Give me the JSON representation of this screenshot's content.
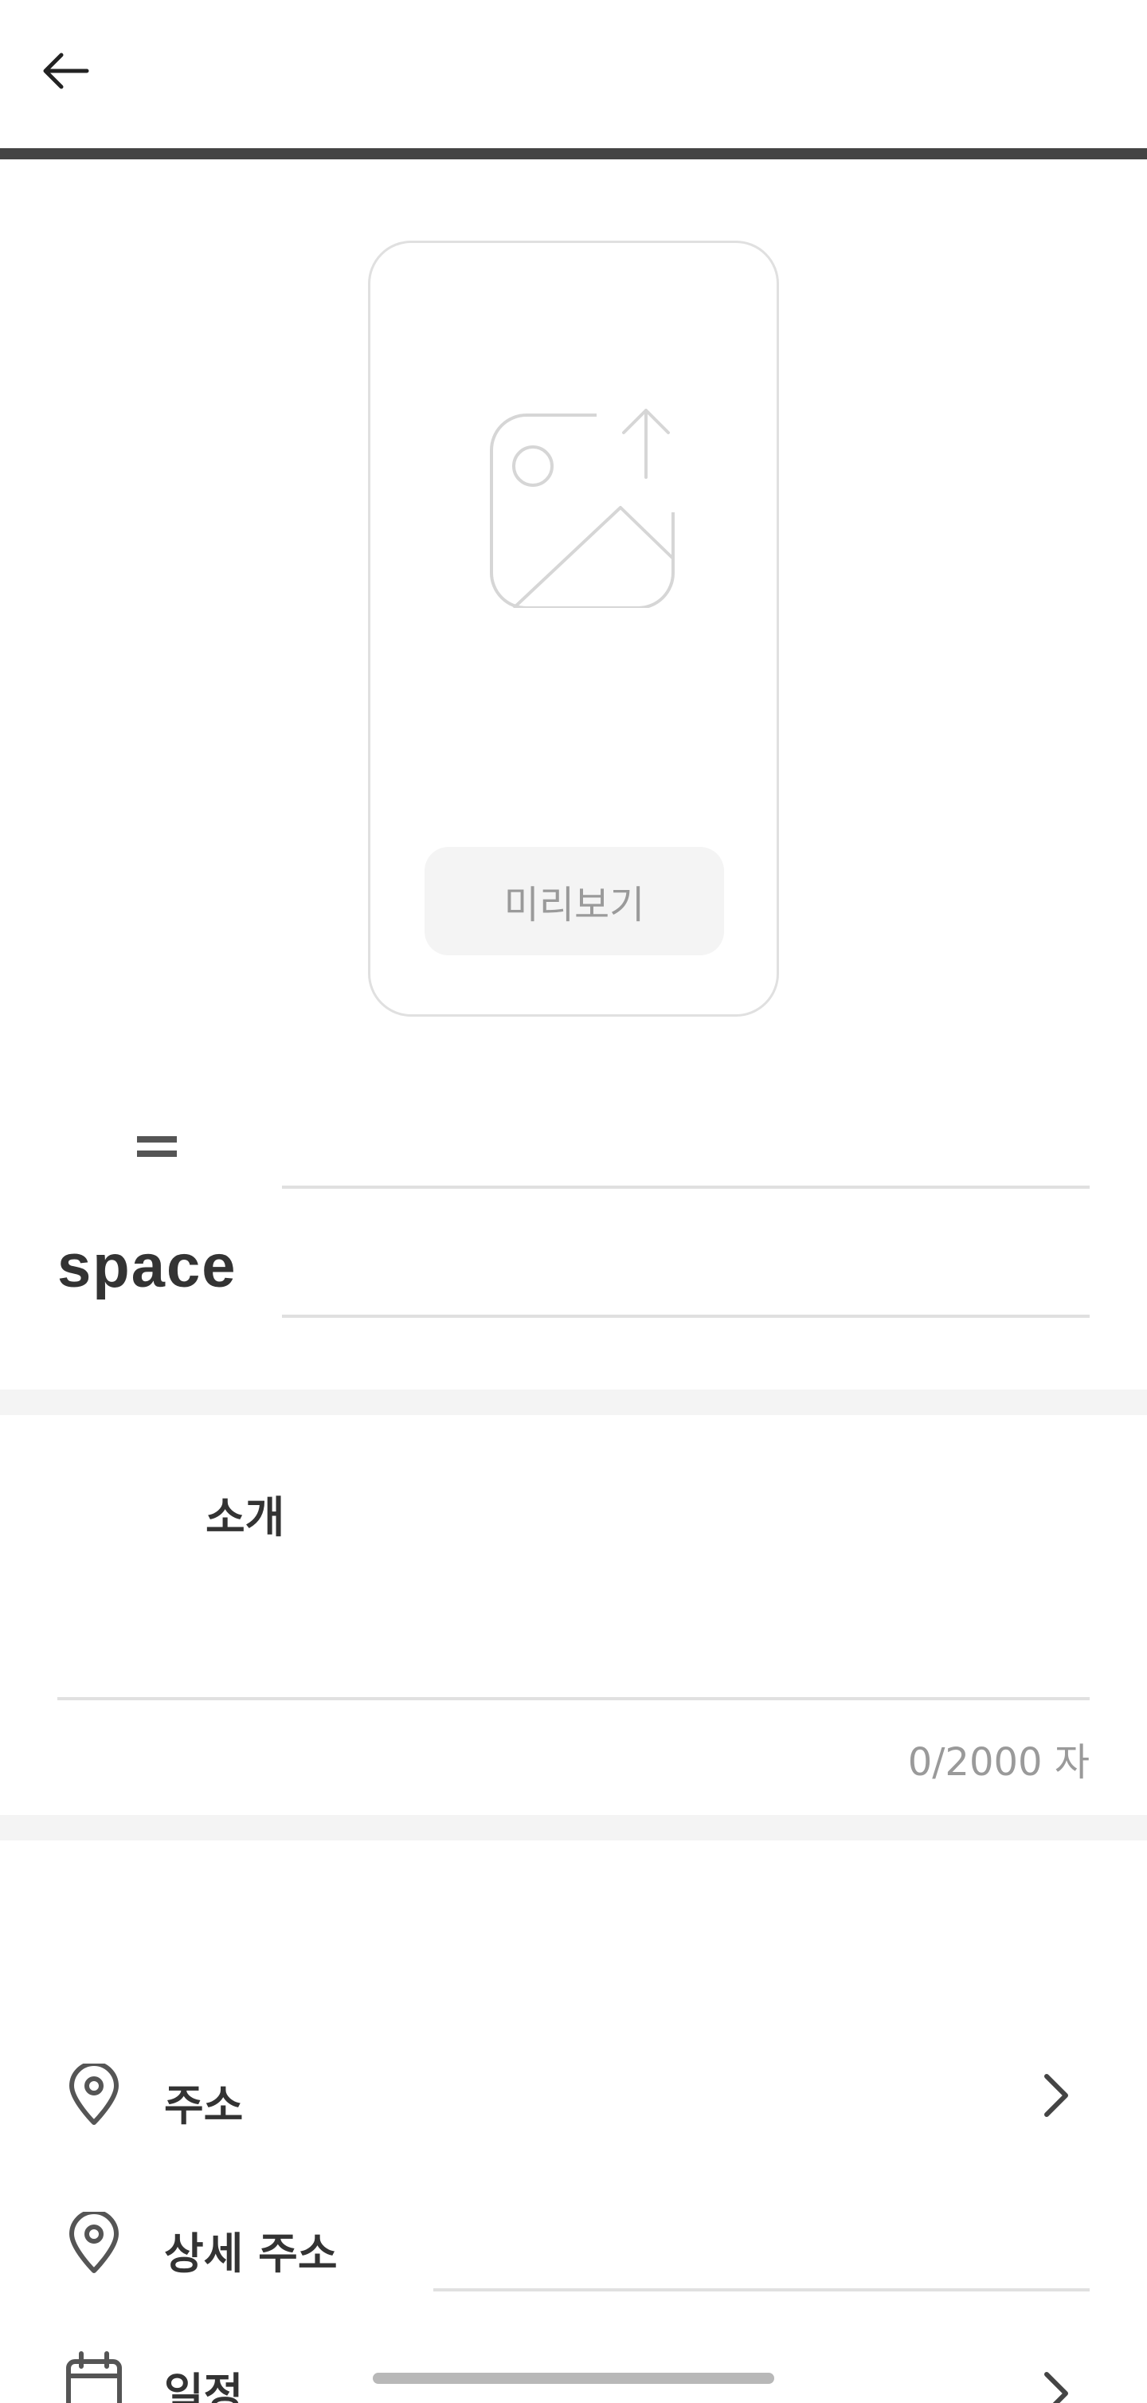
{
  "header": {
    "back_icon": "arrow-left-icon"
  },
  "upload": {
    "icon": "image-upload-icon",
    "preview_label": "미리보기"
  },
  "name_section": {
    "decor_icon": "equals-icon",
    "logo_text": "space"
  },
  "intro": {
    "label": "소개",
    "char_count": "0/2000 자"
  },
  "rows": [
    {
      "label": "주소",
      "icon": "location-pin-icon",
      "chevron": "chevron-right-icon"
    },
    {
      "label": "상세 주소",
      "icon": "location-pin-icon"
    },
    {
      "label": "일정",
      "icon": "calendar-icon",
      "chevron": "chevron-right-icon"
    }
  ],
  "colors": {
    "text": "#333333",
    "muted": "#9a9a9a",
    "line": "#e0e0e0",
    "band": "#f4f4f4",
    "header_rule": "#444444"
  }
}
